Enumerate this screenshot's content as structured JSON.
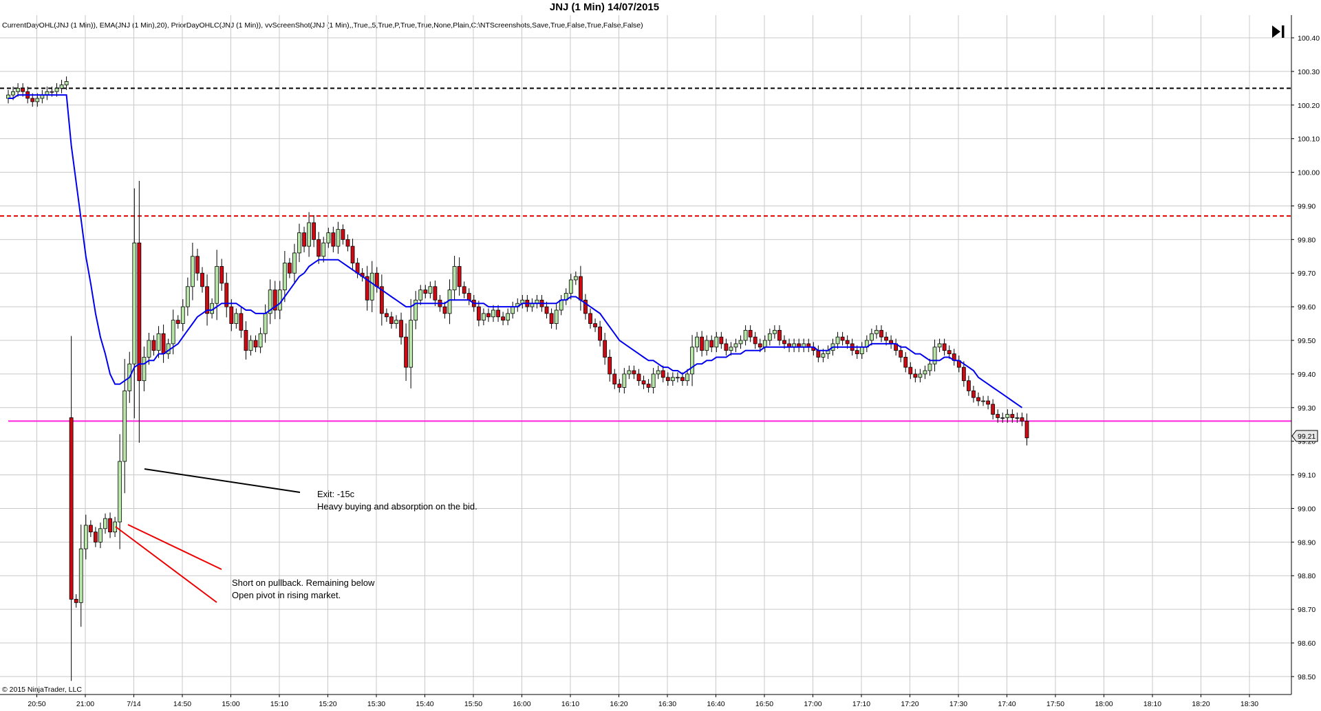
{
  "title": "JNJ (1 Min)  14/07/2015",
  "indicators": "CurrentDayOHL(JNJ (1 Min)), EMA(JNJ (1 Min),20), PriorDayOHLC(JNJ (1 Min)), vvScreenShot(JNJ (1 Min),,True,,5,True,P,True,True,None,Plain,C:\\NTScreenshots,Save,True,False,True,False,False)",
  "copyright": "© 2015 NinjaTrader, LLC",
  "last_price_label": "99.21",
  "annotations": {
    "exit_line1": "Exit: -15c",
    "exit_line2": "Heavy buying and absorption on the bid.",
    "short_line1": "Short on pullback. Remaining below",
    "short_line2": "Open pivot in rising market."
  },
  "colors": {
    "up_candle": "#b8e6a8",
    "down_candle": "#cc0a14",
    "ema": "#0000ee",
    "prior_close": "#000000",
    "prior_high": "#dd0000",
    "prior_low": "#ff22dd",
    "grid": "#c8c8c8",
    "annotation_black": "#000000",
    "annotation_red": "#ee0000"
  },
  "chart_data": {
    "type": "candlestick",
    "symbol": "JNJ",
    "interval": "1 Min",
    "y_axis": {
      "ticks": [
        "100.40",
        "100.30",
        "100.20",
        "100.10",
        "100.00",
        "99.90",
        "99.80",
        "99.70",
        "99.60",
        "99.50",
        "99.40",
        "99.30",
        "99.20",
        "99.10",
        "99.00",
        "98.90",
        "98.80",
        "98.70",
        "98.60",
        "98.50"
      ],
      "ylim": [
        98.46,
        100.44
      ]
    },
    "x_axis": {
      "ticks": [
        "20:50",
        "21:00",
        "7/14",
        "14:50",
        "15:00",
        "15:10",
        "15:20",
        "15:30",
        "15:40",
        "15:50",
        "16:00",
        "16:10",
        "16:20",
        "16:30",
        "16:40",
        "16:50",
        "17:00",
        "17:10",
        "17:20",
        "17:30",
        "17:40",
        "17:50",
        "18:00",
        "18:10",
        "18:20",
        "18:30"
      ]
    },
    "grid": true,
    "horizontal_lines": [
      {
        "price": 100.25,
        "style": "dashed",
        "color": "#000000"
      },
      {
        "price": 99.87,
        "style": "dashed",
        "color": "#dd0000"
      },
      {
        "price": 99.26,
        "style": "solid",
        "color": "#ff22dd"
      }
    ],
    "closes": [
      100.23,
      100.24,
      100.25,
      100.24,
      100.22,
      100.21,
      100.22,
      100.23,
      100.24,
      100.24,
      100.25,
      100.26,
      100.27,
      98.73,
      98.72,
      98.88,
      98.95,
      98.93,
      98.9,
      98.94,
      98.97,
      98.93,
      98.96,
      99.14,
      99.35,
      99.43,
      99.79,
      99.38,
      99.45,
      99.5,
      99.47,
      99.52,
      99.46,
      99.49,
      99.56,
      99.55,
      99.6,
      99.66,
      99.75,
      99.7,
      99.66,
      99.58,
      99.61,
      99.72,
      99.67,
      99.6,
      99.55,
      99.58,
      99.53,
      99.47,
      99.5,
      99.48,
      99.52,
      99.58,
      99.65,
      99.59,
      99.65,
      99.73,
      99.7,
      99.76,
      99.82,
      99.78,
      99.85,
      99.8,
      99.75,
      99.79,
      99.82,
      99.78,
      99.83,
      99.8,
      99.78,
      99.73,
      99.7,
      99.69,
      99.62,
      99.7,
      99.66,
      99.58,
      99.57,
      99.55,
      99.56,
      99.51,
      99.42,
      99.56,
      99.62,
      99.65,
      99.64,
      99.66,
      99.62,
      99.6,
      99.58,
      99.65,
      99.72,
      99.66,
      99.64,
      99.62,
      99.6,
      99.56,
      99.58,
      99.57,
      99.59,
      99.57,
      99.56,
      99.58,
      99.6,
      99.61,
      99.62,
      99.6,
      99.61,
      99.62,
      99.6,
      99.58,
      99.55,
      99.59,
      99.62,
      99.64,
      99.68,
      99.69,
      99.62,
      99.58,
      99.55,
      99.54,
      99.5,
      99.45,
      99.4,
      99.37,
      99.36,
      99.4,
      99.41,
      99.4,
      99.38,
      99.37,
      99.36,
      99.4,
      99.41,
      99.39,
      99.38,
      99.39,
      99.39,
      99.38,
      99.4,
      99.48,
      99.51,
      99.47,
      99.5,
      99.48,
      99.51,
      99.49,
      99.47,
      99.48,
      99.49,
      99.5,
      99.53,
      99.51,
      99.49,
      99.48,
      99.5,
      99.52,
      99.53,
      99.5,
      99.49,
      99.48,
      99.49,
      99.48,
      99.49,
      99.48,
      99.47,
      99.45,
      99.46,
      99.47,
      99.49,
      99.51,
      99.5,
      99.49,
      99.47,
      99.46,
      99.48,
      99.5,
      99.52,
      99.53,
      99.51,
      99.5,
      99.49,
      99.47,
      99.45,
      99.42,
      99.4,
      99.39,
      99.4,
      99.41,
      99.43,
      99.48,
      99.49,
      99.47,
      99.46,
      99.44,
      99.42,
      99.38,
      99.35,
      99.33,
      99.32,
      99.32,
      99.31,
      99.28,
      99.27,
      99.27,
      99.28,
      99.27,
      99.27,
      99.26,
      99.21
    ],
    "ema20": [
      100.22,
      100.22,
      100.23,
      100.23,
      100.23,
      100.23,
      100.23,
      100.23,
      100.23,
      100.23,
      100.23,
      100.23,
      100.23,
      100.08,
      99.97,
      99.86,
      99.75,
      99.67,
      99.58,
      99.51,
      99.46,
      99.4,
      99.37,
      99.37,
      99.38,
      99.39,
      99.42,
      99.43,
      99.43,
      99.44,
      99.44,
      99.46,
      99.46,
      99.47,
      99.48,
      99.49,
      99.51,
      99.53,
      99.55,
      99.57,
      99.58,
      99.59,
      99.59,
      99.6,
      99.61,
      99.61,
      99.61,
      99.61,
      99.6,
      99.59,
      99.59,
      99.58,
      99.58,
      99.58,
      99.59,
      99.6,
      99.61,
      99.63,
      99.65,
      99.67,
      99.69,
      99.7,
      99.72,
      99.73,
      99.74,
      99.74,
      99.74,
      99.74,
      99.74,
      99.73,
      99.72,
      99.71,
      99.7,
      99.69,
      99.68,
      99.67,
      99.66,
      99.65,
      99.64,
      99.63,
      99.62,
      99.61,
      99.6,
      99.6,
      99.61,
      99.61,
      99.61,
      99.61,
      99.61,
      99.61,
      99.61,
      99.62,
      99.62,
      99.62,
      99.62,
      99.62,
      99.61,
      99.61,
      99.61,
      99.6,
      99.6,
      99.6,
      99.6,
      99.6,
      99.6,
      99.6,
      99.61,
      99.61,
      99.61,
      99.61,
      99.61,
      99.61,
      99.61,
      99.61,
      99.62,
      99.62,
      99.63,
      99.63,
      99.62,
      99.61,
      99.6,
      99.59,
      99.58,
      99.56,
      99.54,
      99.52,
      99.5,
      99.49,
      99.48,
      99.47,
      99.46,
      99.45,
      99.44,
      99.44,
      99.43,
      99.42,
      99.42,
      99.41,
      99.41,
      99.4,
      99.41,
      99.42,
      99.43,
      99.43,
      99.44,
      99.44,
      99.45,
      99.45,
      99.45,
      99.46,
      99.46,
      99.46,
      99.47,
      99.47,
      99.47,
      99.47,
      99.48,
      99.48,
      99.48,
      99.48,
      99.48,
      99.48,
      99.48,
      99.48,
      99.48,
      99.48,
      99.48,
      99.47,
      99.47,
      99.47,
      99.48,
      99.48,
      99.48,
      99.48,
      99.48,
      99.48,
      99.48,
      99.48,
      99.49,
      99.49,
      99.49,
      99.49,
      99.49,
      99.49,
      99.48,
      99.48,
      99.47,
      99.46,
      99.46,
      99.45,
      99.44,
      99.44,
      99.44,
      99.45,
      99.45,
      99.44,
      99.44,
      99.43,
      99.42,
      99.41,
      99.39,
      99.38,
      99.37,
      99.36,
      99.35,
      99.34,
      99.33,
      99.32,
      99.31,
      99.3
    ]
  }
}
